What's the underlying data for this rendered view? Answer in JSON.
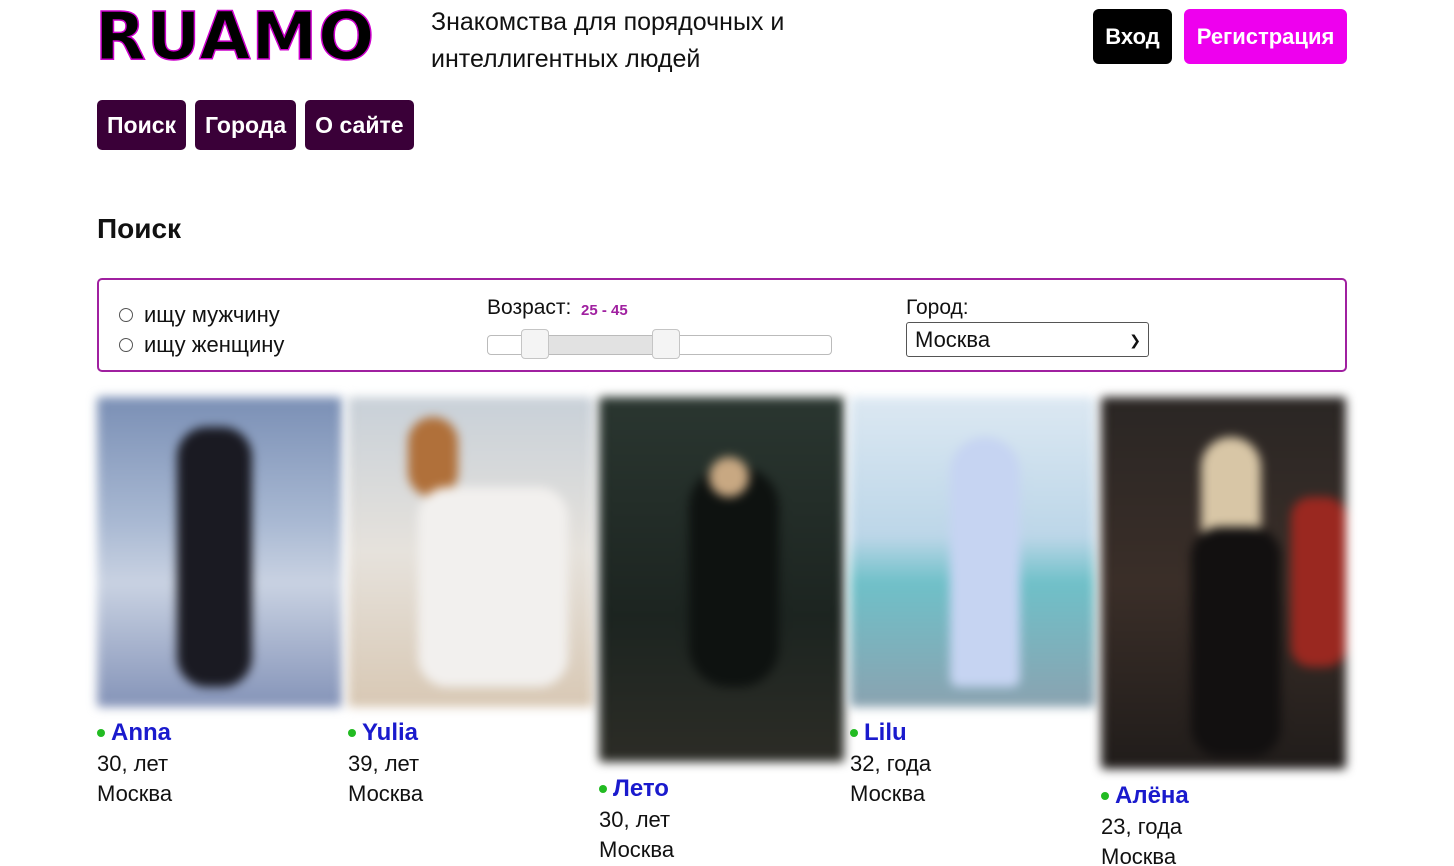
{
  "header": {
    "logo": "RUAMO",
    "tagline": "Знакомства для порядочных и интеллигентных людей",
    "login_label": "Вход",
    "register_label": "Регистрация"
  },
  "nav": [
    "Поиск",
    "Города",
    "О сайте"
  ],
  "page_title": "Поиск",
  "filter": {
    "gender_options": [
      "ищу мужчину",
      "ищу женщину"
    ],
    "age_label": "Возраст:",
    "age_value": "25 - 45",
    "age_min": 25,
    "age_max": 45,
    "city_label": "Город:",
    "city_selected": "Москва"
  },
  "profiles": [
    {
      "name": "Anna",
      "age": "30, лет",
      "city": "Москва",
      "online": true
    },
    {
      "name": "Yulia",
      "age": "39, лет",
      "city": "Москва",
      "online": true
    },
    {
      "name": "Лето",
      "age": "30, лет",
      "city": "Москва",
      "online": true
    },
    {
      "name": "Lilu",
      "age": "32, года",
      "city": "Москва",
      "online": true
    },
    {
      "name": "Алёна",
      "age": "23, года",
      "city": "Москва",
      "online": true
    }
  ],
  "colors": {
    "accent": "#ee00ee",
    "nav_bg": "#3a0038",
    "border": "#a020a0",
    "link": "#1a1acd",
    "online": "#22bb22"
  }
}
